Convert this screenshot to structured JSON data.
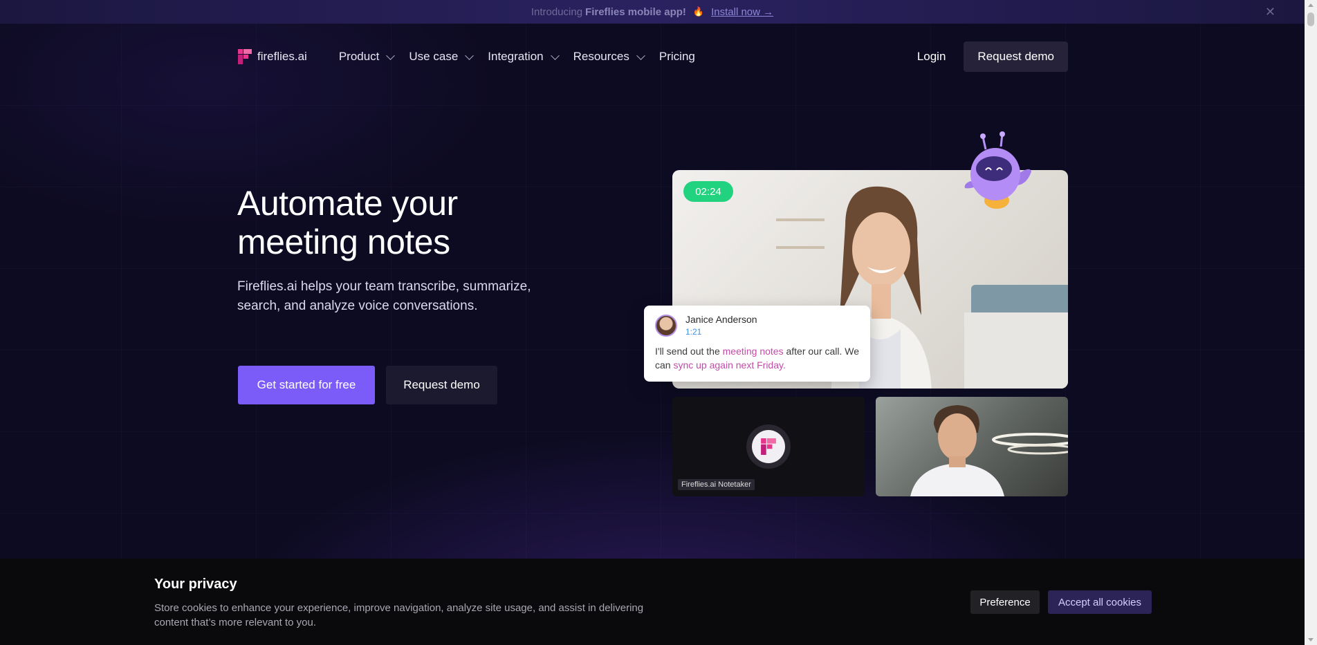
{
  "announcement": {
    "prefix": "Introducing",
    "bold": "Fireflies mobile app!",
    "link": "Install now →",
    "close": "✕"
  },
  "nav": {
    "logo_text": "fireflies.ai",
    "items": [
      {
        "label": "Product",
        "has_dropdown": true
      },
      {
        "label": "Use case",
        "has_dropdown": true
      },
      {
        "label": "Integration",
        "has_dropdown": true
      },
      {
        "label": "Resources",
        "has_dropdown": true
      },
      {
        "label": "Pricing",
        "has_dropdown": false
      }
    ],
    "login": "Login",
    "request_demo": "Request demo"
  },
  "hero": {
    "title_line1": "Automate your",
    "title_line2": "meeting notes",
    "subtitle": "Fireflies.ai helps your team transcribe, summarize, search, and analyze voice conversations.",
    "primary_cta": "Get started for free",
    "secondary_cta": "Request demo"
  },
  "demo": {
    "timer": "02:24",
    "chat": {
      "name": "Janice Anderson",
      "time": "1:21",
      "text_1": "I'll send out the ",
      "highlight_1": "meeting notes",
      "text_2": " after our call. We can ",
      "highlight_2": "sync up again next Friday."
    },
    "notetaker_label": "Fireflies.ai Notetaker"
  },
  "cookie": {
    "title": "Your privacy",
    "text": "Store cookies to enhance your experience, improve navigation, analyze site usage, and assist in delivering content that’s more relevant to you.",
    "preference": "Preference",
    "accept": "Accept all cookies"
  },
  "colors": {
    "background": "#0d0b22",
    "accent": "#7c5cf8",
    "timer_green": "#21d27f",
    "highlight_pink": "#c34aa9"
  }
}
